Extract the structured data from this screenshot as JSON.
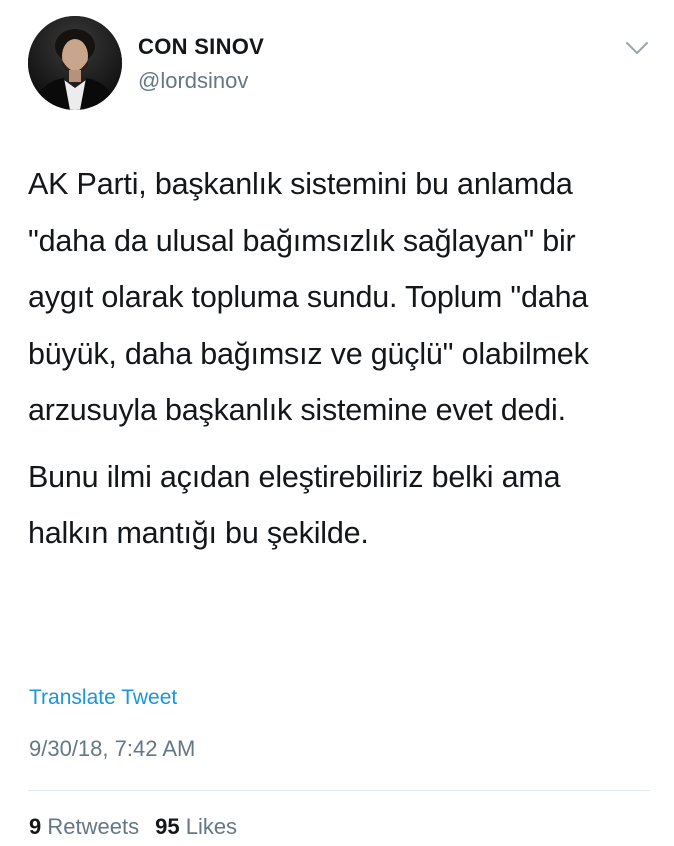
{
  "user": {
    "display_name": "CON SINOV",
    "handle": "@lordsinov"
  },
  "tweet": {
    "paragraphs": [
      "AK Parti, başkanlık sistemini bu anlamda \"daha da ulusal bağımsızlık sağlayan\" bir aygıt olarak topluma sundu. Toplum \"daha büyük, daha bağımsız ve güçlü\" olabilmek arzusuyla başkanlık sistemine evet dedi.",
      "Bunu ilmi açıdan eleştirebiliriz belki ama halkın mantığı bu şekilde."
    ],
    "translate_label": "Translate Tweet",
    "timestamp": "9/30/18, 7:42 AM"
  },
  "stats": {
    "retweets_count": "9",
    "retweets_label": "Retweets",
    "likes_count": "95",
    "likes_label": "Likes"
  },
  "icons": {
    "menu": "chevron-down-icon"
  },
  "colors": {
    "link": "#1b95e0",
    "secondary_text": "#657786",
    "primary_text": "#14171a",
    "divider": "#e1e8ed"
  }
}
